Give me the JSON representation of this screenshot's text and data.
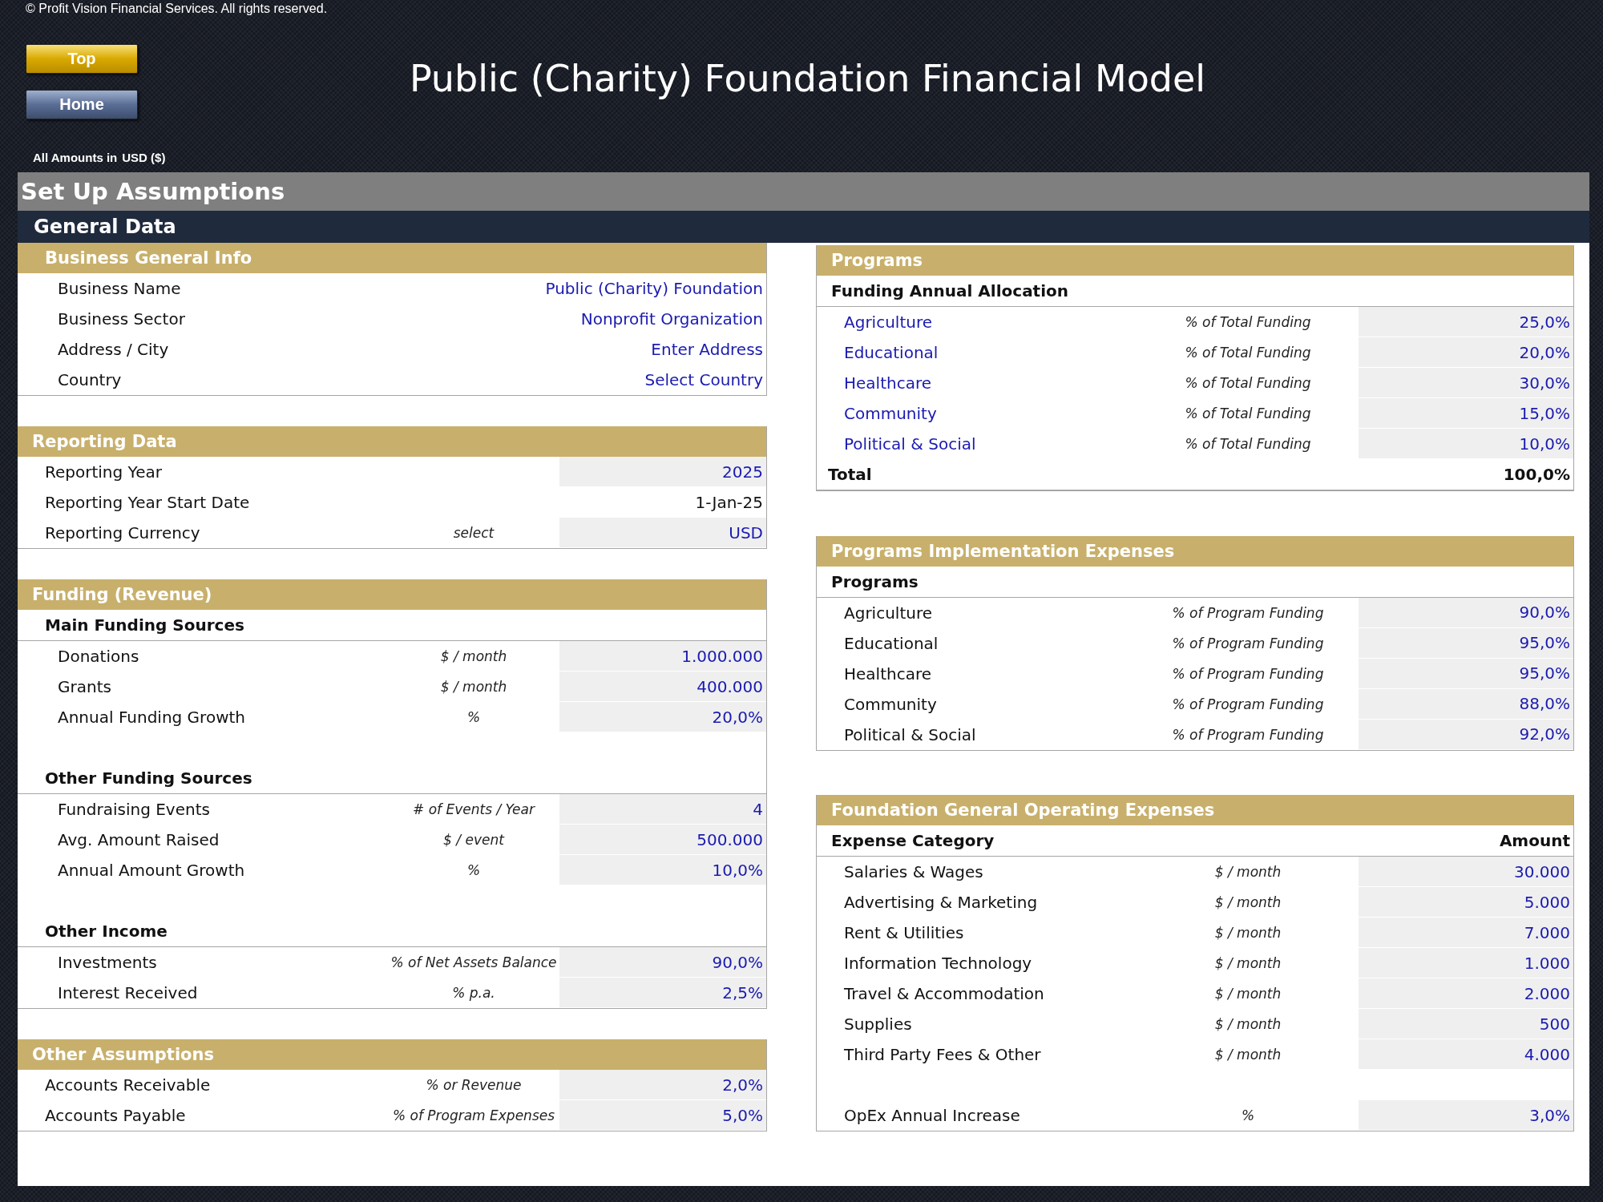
{
  "copyright": "© Profit Vision Financial Services. All rights reserved.",
  "nav_buttons": [
    {
      "label": "Top",
      "kind": "gold"
    },
    {
      "label": "Home",
      "kind": "steel"
    }
  ],
  "title": "Public (Charity) Foundation Financial Model",
  "currency_note": {
    "label": "All Amounts in",
    "value": "USD ($)"
  },
  "section_title": "Set Up Assumptions",
  "subsection_title": "General Data",
  "left_column": [
    {
      "title": "Business General Info",
      "groups": [
        {
          "rows": [
            {
              "kind": "info",
              "label": "Business Name",
              "value": "Public (Charity) Foundation"
            },
            {
              "kind": "info",
              "label": "Business Sector",
              "value": "Nonprofit Organization"
            },
            {
              "kind": "info",
              "label": "Address / City",
              "value": "Enter Address"
            },
            {
              "kind": "info",
              "label": "Country",
              "value": "Select Country"
            }
          ]
        }
      ]
    },
    {
      "title": "Reporting Data",
      "groups": [
        {
          "rows": [
            {
              "kind": "input",
              "label": "Reporting Year",
              "value": "2025"
            },
            {
              "kind": "formula",
              "label": "Reporting Year Start Date",
              "value": "1-Jan-25"
            },
            {
              "kind": "input",
              "label": "Reporting Currency",
              "unit": "select",
              "value": "USD"
            }
          ]
        }
      ]
    },
    {
      "title": "Funding (Revenue)",
      "groups": [
        {
          "heading": {
            "label": "Main Funding Sources"
          },
          "rows": [
            {
              "kind": "input",
              "label": "Donations",
              "unit": "$ / month",
              "value": "1.000.000"
            },
            {
              "kind": "input",
              "label": "Grants",
              "unit": "$ / month",
              "value": "400.000"
            },
            {
              "kind": "input",
              "label": "Annual Funding Growth",
              "unit": "%",
              "value": "20,0%"
            }
          ]
        },
        {
          "heading": {
            "label": "Other Funding Sources"
          },
          "rows": [
            {
              "kind": "input",
              "label": "Fundraising Events",
              "unit": "# of Events / Year",
              "value": "4"
            },
            {
              "kind": "input",
              "label": "Avg. Amount Raised",
              "unit": "$ / event",
              "value": "500.000"
            },
            {
              "kind": "input",
              "label": "Annual Amount Growth",
              "unit": "%",
              "value": "10,0%"
            }
          ]
        },
        {
          "heading": {
            "label": "Other Income"
          },
          "rows": [
            {
              "kind": "input",
              "label": "Investments",
              "unit": "% of Net Assets Balance",
              "value": "90,0%"
            },
            {
              "kind": "input",
              "label": "Interest Received",
              "unit": "% p.a.",
              "value": "2,5%"
            }
          ]
        }
      ]
    },
    {
      "title": "Other Assumptions",
      "groups": [
        {
          "rows": [
            {
              "kind": "input",
              "label": "Accounts Receivable",
              "unit": "% or Revenue",
              "value": "2,0%"
            },
            {
              "kind": "input",
              "label": "Accounts Payable",
              "unit": "% of Program Expenses",
              "value": "5,0%"
            }
          ]
        }
      ]
    }
  ],
  "right_column": [
    {
      "title": "Programs",
      "groups": [
        {
          "heading": {
            "label": "Funding Annual Allocation"
          },
          "rows": [
            {
              "kind": "allocation",
              "label": "Agriculture",
              "unit": "% of Total Funding",
              "value": "25,0%"
            },
            {
              "kind": "allocation",
              "label": "Educational",
              "unit": "% of Total Funding",
              "value": "20,0%"
            },
            {
              "kind": "allocation",
              "label": "Healthcare",
              "unit": "% of Total Funding",
              "value": "30,0%"
            },
            {
              "kind": "allocation",
              "label": "Community",
              "unit": "% of Total Funding",
              "value": "15,0%"
            },
            {
              "kind": "allocation",
              "label": "Political & Social",
              "unit": "% of Total Funding",
              "value": "10,0%"
            },
            {
              "kind": "total",
              "label": "Total",
              "value": "100,0%"
            }
          ]
        }
      ]
    },
    {
      "title": "Programs Implementation Expenses",
      "groups": [
        {
          "heading": {
            "label": "Programs"
          },
          "rows": [
            {
              "kind": "input",
              "label": "Agriculture",
              "unit": "% of Program Funding",
              "value": "90,0%"
            },
            {
              "kind": "input",
              "label": "Educational",
              "unit": "% of Program Funding",
              "value": "95,0%"
            },
            {
              "kind": "input",
              "label": "Healthcare",
              "unit": "% of Program Funding",
              "value": "95,0%"
            },
            {
              "kind": "input",
              "label": "Community",
              "unit": "% of Program Funding",
              "value": "88,0%"
            },
            {
              "kind": "input",
              "label": "Political & Social",
              "unit": "% of Program Funding",
              "value": "92,0%"
            }
          ]
        }
      ]
    },
    {
      "title": "Foundation General Operating Expenses",
      "groups": [
        {
          "heading": {
            "label": "Expense Category",
            "right": "Amount"
          },
          "rows": [
            {
              "kind": "input",
              "label": "Salaries & Wages",
              "unit": "$ / month",
              "value": "30.000"
            },
            {
              "kind": "input",
              "label": "Advertising & Marketing",
              "unit": "$ / month",
              "value": "5.000"
            },
            {
              "kind": "input",
              "label": "Rent & Utilities",
              "unit": "$ / month",
              "value": "7.000"
            },
            {
              "kind": "input",
              "label": "Information Technology",
              "unit": "$ / month",
              "value": "1.000"
            },
            {
              "kind": "input",
              "label": "Travel & Accommodation",
              "unit": "$ / month",
              "value": "2.000"
            },
            {
              "kind": "input",
              "label": "Supplies",
              "unit": "$ / month",
              "value": "500"
            },
            {
              "kind": "input",
              "label": "Third Party Fees & Other",
              "unit": "$ / month",
              "value": "4.000"
            }
          ]
        },
        {
          "rows": [
            {
              "kind": "input",
              "label": "OpEx Annual Increase",
              "unit": "%",
              "value": "3,0%"
            }
          ]
        }
      ]
    }
  ]
}
